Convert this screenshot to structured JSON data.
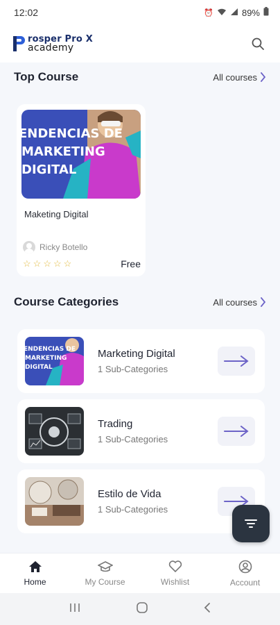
{
  "status_bar": {
    "time": "12:02",
    "battery": "89%"
  },
  "header": {
    "logo_line1": "rosper Pro X",
    "logo_line2": "academy",
    "search_icon": "search-icon"
  },
  "top_course": {
    "title": "Top Course",
    "all_link": "All courses",
    "course": {
      "thumb_lines": [
        "ENDENCIAS DE",
        "MARKETING",
        "DIGITAL"
      ],
      "name": "Maketing Digital",
      "instructor": "Ricky Botello",
      "rating_stars": 5,
      "price": "Free"
    }
  },
  "categories": {
    "title": "Course Categories",
    "all_link": "All courses",
    "items": [
      {
        "name": "Marketing Digital",
        "sub": "1 Sub-Categories"
      },
      {
        "name": "Trading",
        "sub": "1 Sub-Categories"
      },
      {
        "name": "Estilo de Vida",
        "sub": "1 Sub-Categories"
      }
    ]
  },
  "bottom_nav": [
    {
      "label": "Home",
      "icon": "home-icon",
      "active": true
    },
    {
      "label": "My Course",
      "icon": "graduation-cap-icon",
      "active": false
    },
    {
      "label": "Wishlist",
      "icon": "heart-icon",
      "active": false
    },
    {
      "label": "Account",
      "icon": "account-icon",
      "active": false
    }
  ],
  "colors": {
    "accent": "#6c63c7",
    "fab": "#2b3440",
    "background": "#f5f7fb"
  }
}
